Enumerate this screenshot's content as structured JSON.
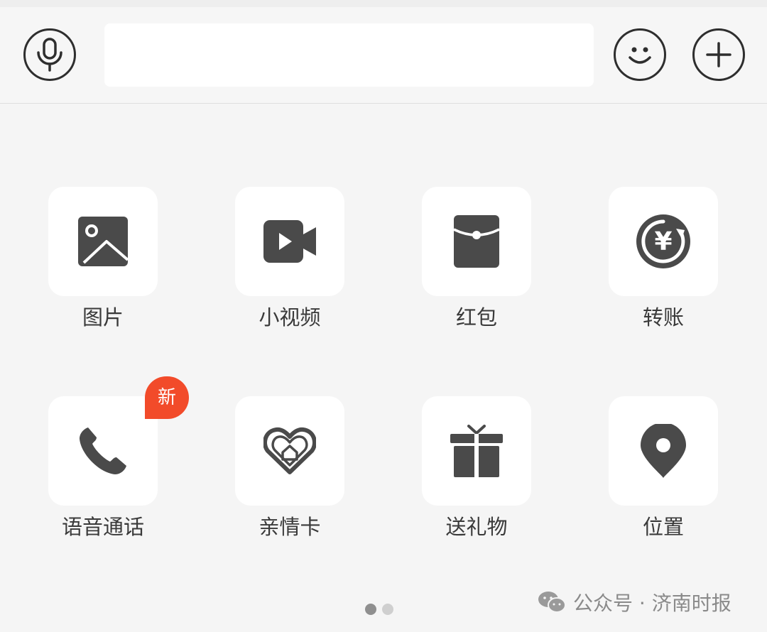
{
  "input_bar": {
    "voice_icon": "microphone-icon",
    "emoji_icon": "smiley-icon",
    "more_icon": "plus-icon",
    "message_value": "",
    "message_placeholder": ""
  },
  "panel": {
    "items": [
      {
        "label": "图片",
        "icon": "image-icon"
      },
      {
        "label": "小视频",
        "icon": "video-camera-icon"
      },
      {
        "label": "红包",
        "icon": "red-packet-icon"
      },
      {
        "label": "转账",
        "icon": "yuan-transfer-icon"
      },
      {
        "label": "语音通话",
        "icon": "phone-icon",
        "badge": "新"
      },
      {
        "label": "亲情卡",
        "icon": "heart-home-icon"
      },
      {
        "label": "送礼物",
        "icon": "gift-icon"
      },
      {
        "label": "位置",
        "icon": "location-pin-icon"
      }
    ],
    "page_count": 2,
    "active_page": 1
  },
  "watermark": {
    "icon": "wechat-icon",
    "text": "公众号 · 济南时报"
  },
  "colors": {
    "icon": "#4a4a4a",
    "badge": "#f24b2a",
    "tile_bg": "#ffffff",
    "panel_bg": "#f5f5f5"
  }
}
